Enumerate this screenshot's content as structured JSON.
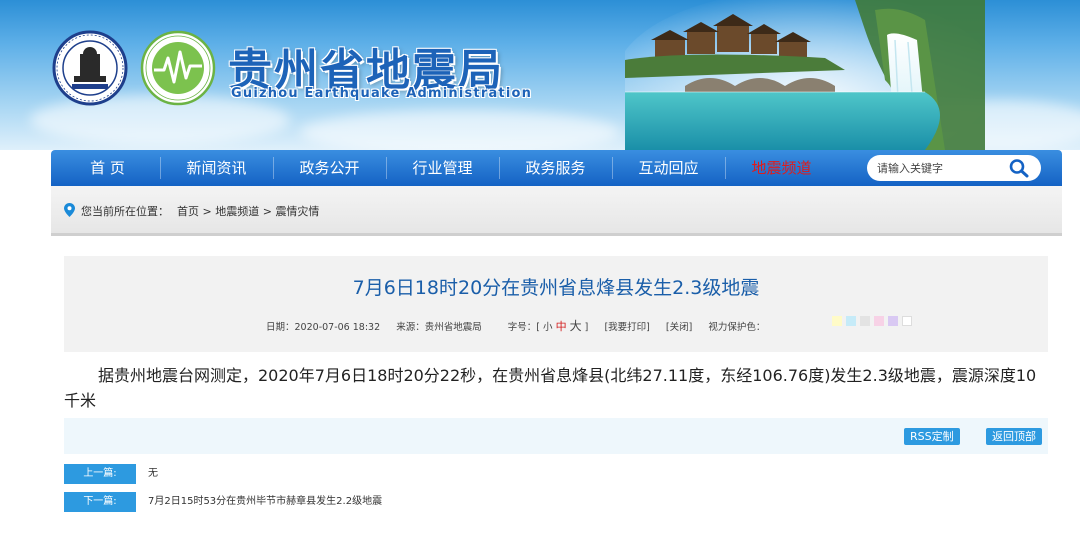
{
  "header": {
    "title": "贵州省地震局",
    "subtitle": "Guizhou Earthquake Administration",
    "logo1_text": "CHINA EARTHQUAKE ADMINISTRATION",
    "logo2_text": "贵州省地震局"
  },
  "nav": {
    "items": [
      "首 页",
      "新闻资讯",
      "政务公开",
      "行业管理",
      "政务服务",
      "互动回应",
      "地震频道"
    ],
    "active_index": 6,
    "search_placeholder": "请输入关键字"
  },
  "breadcrumb": {
    "prefix": "您当前所在位置：",
    "items": [
      "首页",
      "地震频道",
      "震情灾情"
    ],
    "separator": ">"
  },
  "article": {
    "title": "7月6日18时20分在贵州省息烽县发生2.3级地震",
    "meta": {
      "date_label": "日期：",
      "date": "2020-07-06 18:32",
      "source_label": "来源：",
      "source": "贵州省地震局",
      "font_label": "字号：[",
      "font_small": "小",
      "font_mid": "中",
      "font_big": "大",
      "font_close": "]",
      "print": "[我要打印]",
      "close": "[关闭]",
      "eye_label": "视力保护色："
    },
    "eye_colors": [
      "#fffbc8",
      "#c6ebf8",
      "#e3e3e3",
      "#f7d2e6",
      "#d9c9f3",
      "#ffffff"
    ],
    "body": "据贵州地震台网测定，2020年7月6日18时20分22秒，在贵州省息烽县(北纬27.11度，东经106.76度)发生2.3级地震，震源深度10千米"
  },
  "tools": {
    "rss": "RSS定制",
    "top": "返回顶部"
  },
  "pager": {
    "prev_label": "上一篇:",
    "prev_text": "无",
    "next_label": "下一篇:",
    "next_text": "7月2日15时53分在贵州毕节市赫章县发生2.2级地震"
  },
  "colors": {
    "nav_blue": "#1462c4",
    "title_blue": "#1a5ea9",
    "active_red": "#e01b1b",
    "button_blue": "#2d9ae0"
  }
}
